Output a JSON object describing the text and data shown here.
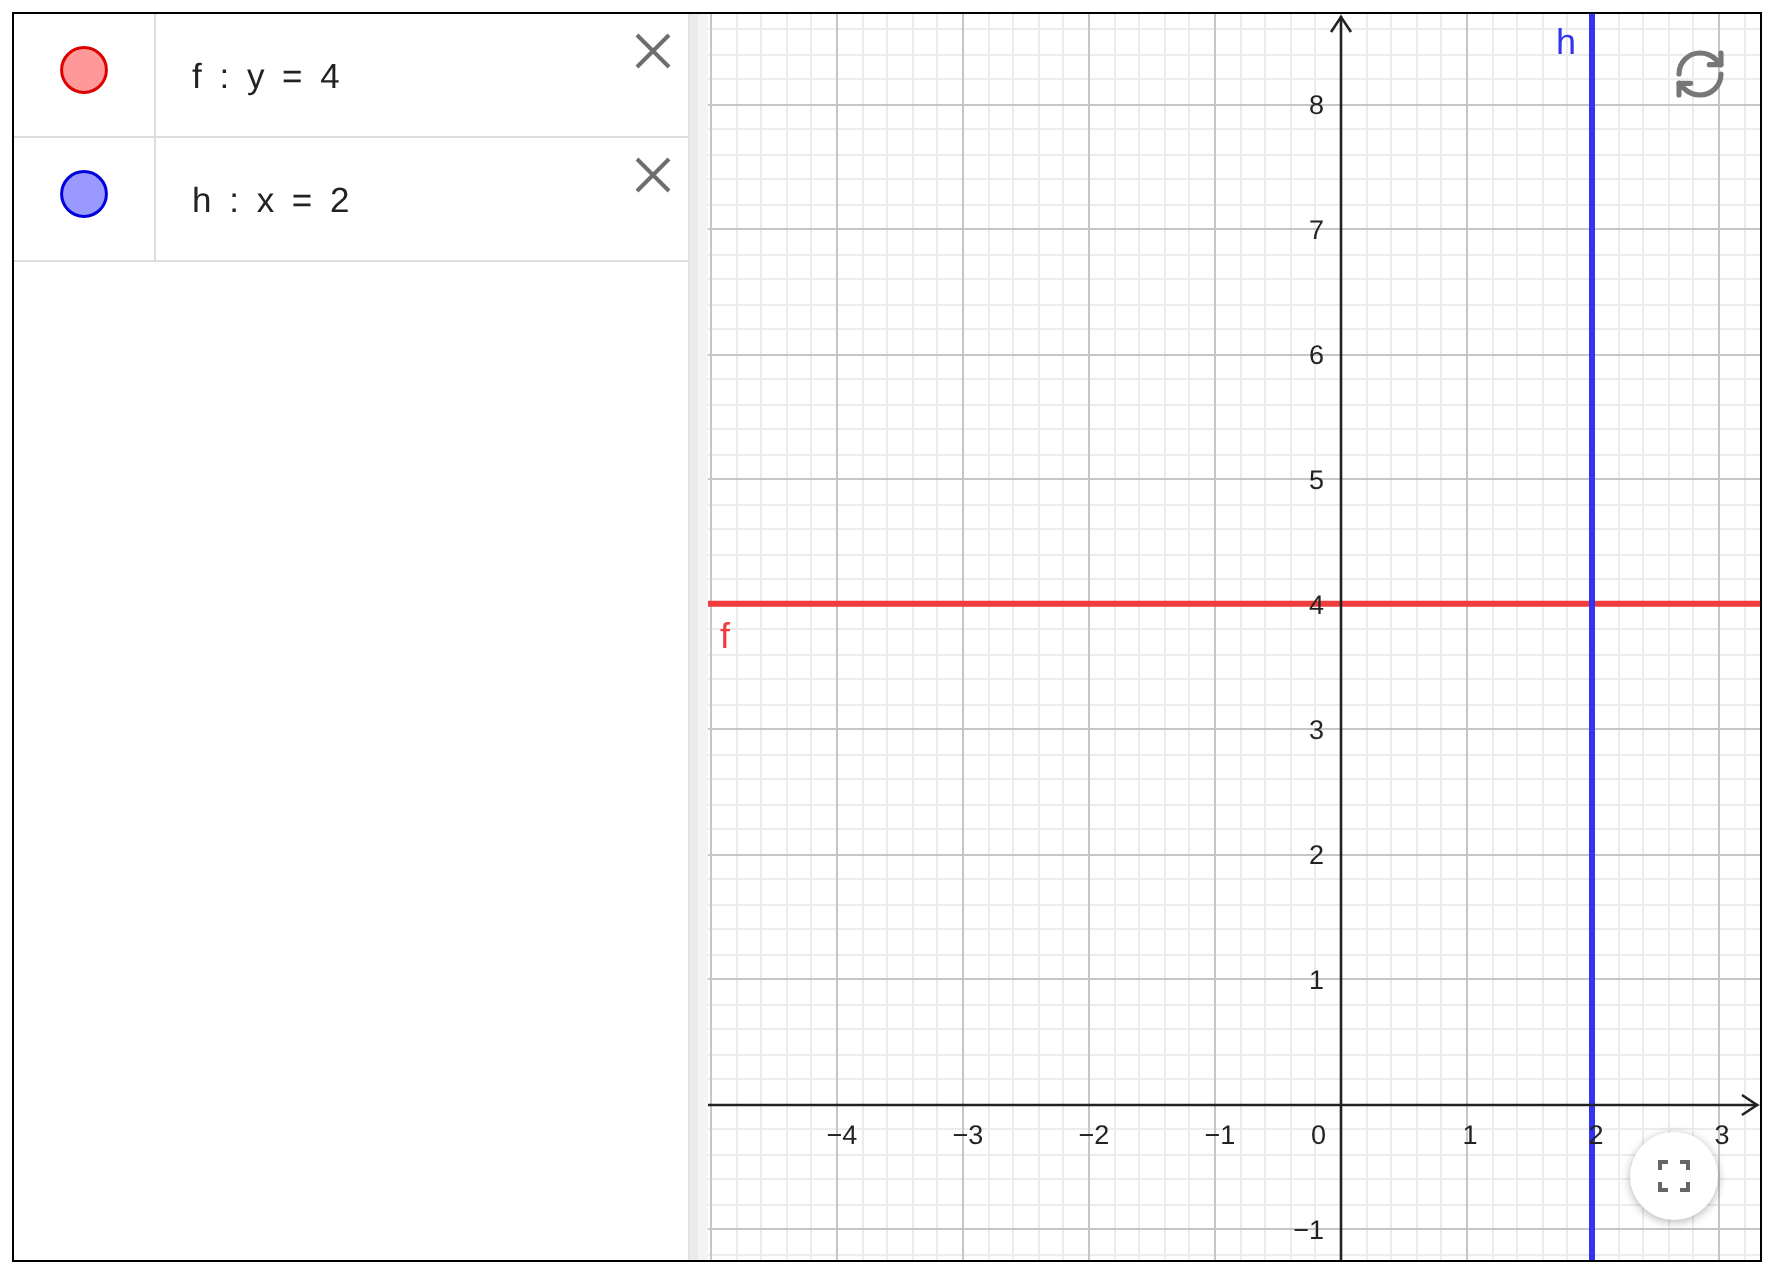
{
  "algebra": {
    "items": [
      {
        "text": "f : y = 4",
        "color": "#ff9999"
      },
      {
        "text": "h : x = 2",
        "color": "#9999ff"
      }
    ]
  },
  "graphics": {
    "origin_label": "0",
    "chart_data": {
      "type": "line",
      "grid": true,
      "xlim": [
        -5.016,
        3.333
      ],
      "ylim": [
        -1.25,
        8.72
      ],
      "xticks": [
        {
          "value": -4,
          "label": "−4"
        },
        {
          "value": -3,
          "label": "−3"
        },
        {
          "value": -2,
          "label": "−2"
        },
        {
          "value": -1,
          "label": "−1"
        },
        1,
        2,
        3
      ],
      "yticks": [
        {
          "value": -1,
          "label": "−1"
        },
        1,
        2,
        3,
        4,
        5,
        6,
        7,
        8
      ],
      "series": [
        {
          "name": "f",
          "color": "#f03c3c",
          "x": [
            -5.016,
            3.333
          ],
          "values": [
            4,
            4
          ]
        },
        {
          "name": "h",
          "color": "#3434f0",
          "x": [
            2,
            2
          ],
          "values": [
            -1.25,
            8.72
          ]
        }
      ]
    }
  }
}
